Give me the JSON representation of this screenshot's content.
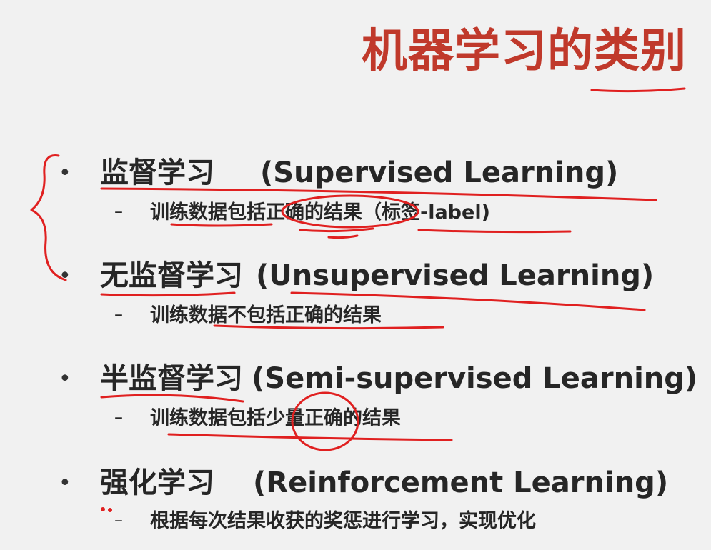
{
  "slide": {
    "title": "机器学习的类别",
    "items": [
      {
        "zh": "监督学习",
        "en": "(Supervised Learning)",
        "sub": "训练数据包括正确的结果（标签-label)"
      },
      {
        "zh": "无监督学习",
        "en": "(Unsupervised Learning)",
        "sub": "训练数据不包括正确的结果"
      },
      {
        "zh": "半监督学习",
        "en": "(Semi-supervised Learning)",
        "sub": "训练数据包括少量正确的结果"
      },
      {
        "zh": "强化学习",
        "en": "(Reinforcement Learning)",
        "sub": "根据每次结果收获的奖惩进行学习，实现优化"
      }
    ],
    "bullet": "•",
    "dash": "–",
    "ink_color": "#e02020",
    "title_color": "#c0392b"
  }
}
